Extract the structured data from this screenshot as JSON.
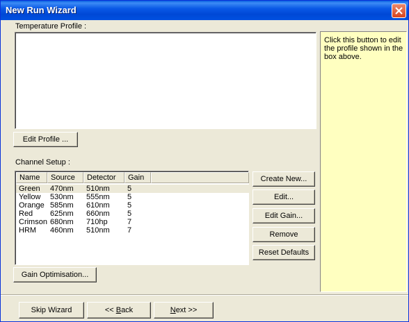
{
  "window": {
    "title": "New Run Wizard"
  },
  "temperature_profile": {
    "label": "Temperature Profile :"
  },
  "edit_profile_button": "Edit Profile ...",
  "help_text": "Click this button to edit the profile shown in the box above.",
  "channel_setup": {
    "label": "Channel Setup :",
    "columns": [
      "Name",
      "Source",
      "Detector",
      "Gain"
    ],
    "rows": [
      [
        "Green",
        "470nm",
        "510nm",
        "5"
      ],
      [
        "Yellow",
        "530nm",
        "555nm",
        "5"
      ],
      [
        "Orange",
        "585nm",
        "610nm",
        "5"
      ],
      [
        "Red",
        "625nm",
        "660nm",
        "5"
      ],
      [
        "Crimson",
        "680nm",
        "710hp",
        "7"
      ],
      [
        "HRM",
        "460nm",
        "510nm",
        "7"
      ]
    ],
    "selected_row": "Green"
  },
  "side_buttons": {
    "create_new": "Create New...",
    "edit": "Edit...",
    "edit_gain": "Edit Gain...",
    "remove": "Remove",
    "reset_defaults": "Reset Defaults"
  },
  "gain_optimisation_button": "Gain Optimisation...",
  "footer": {
    "skip_wizard": "Skip Wizard",
    "back": "<< Back",
    "next": "Next >>"
  },
  "colors": {
    "titlebar": "#0a59e6",
    "window_bg": "#ece9d8",
    "help_bg": "#ffffc0",
    "close_button": "#d8431e"
  },
  "icons": {
    "close": "close-icon"
  }
}
